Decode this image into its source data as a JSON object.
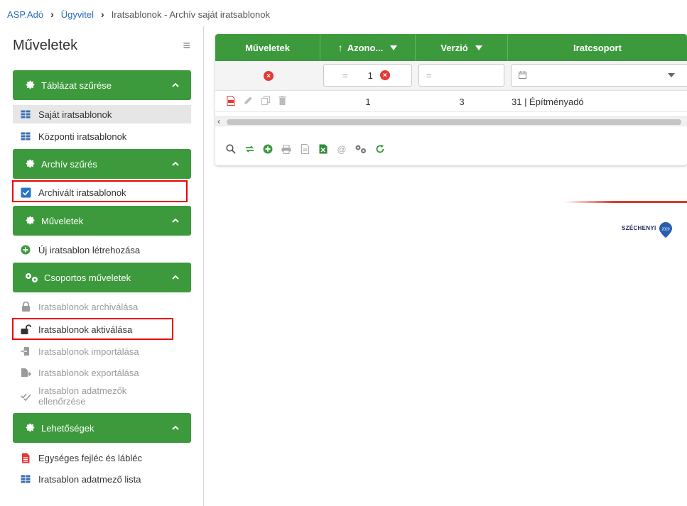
{
  "breadcrumb": {
    "items": [
      "ASP.Adó",
      "Ügyvitel"
    ],
    "current": "Iratsablonok - Archív saját iratsablonok"
  },
  "sidebar": {
    "title": "Műveletek",
    "groups": [
      {
        "label": "Táblázat szűrése",
        "icon": "gear-icon",
        "items": [
          {
            "label": "Saját iratsablonok",
            "icon": "table-icon",
            "state": "active"
          },
          {
            "label": "Központi iratsablonok",
            "icon": "table-icon",
            "state": "normal"
          }
        ]
      },
      {
        "label": "Archív szűrés",
        "icon": "gear-icon",
        "items": [
          {
            "label": "Archivált iratsablonok",
            "icon": "checkbox-checked-icon",
            "state": "highlighted",
            "checked": true
          }
        ]
      },
      {
        "label": "Műveletek",
        "icon": "gear-icon",
        "items": [
          {
            "label": "Új iratsablon létrehozása",
            "icon": "plus-circle-icon",
            "state": "normal"
          }
        ]
      },
      {
        "label": "Csoportos műveletek",
        "icon": "gears-icon",
        "items": [
          {
            "label": "Iratsablonok archiválása",
            "icon": "lock-icon",
            "state": "disabled"
          },
          {
            "label": "Iratsablonok aktiválása",
            "icon": "unlock-icon",
            "state": "highlighted"
          },
          {
            "label": "Iratsablonok importálása",
            "icon": "import-icon",
            "state": "disabled"
          },
          {
            "label": "Iratsablonok exportálása",
            "icon": "export-icon",
            "state": "disabled"
          },
          {
            "label": "Iratsablon adatmezők ellenőrzése",
            "icon": "check-double-icon",
            "state": "disabled"
          }
        ]
      },
      {
        "label": "Lehetőségek",
        "icon": "gear-icon",
        "items": [
          {
            "label": "Egységes fejléc és lábléc",
            "icon": "file-icon",
            "state": "normal"
          },
          {
            "label": "Iratsablon adatmező lista",
            "icon": "table-icon",
            "state": "normal"
          }
        ]
      }
    ]
  },
  "grid": {
    "columns": [
      {
        "label": "Műveletek"
      },
      {
        "label": "Azono...",
        "sort": "asc",
        "filterable": true
      },
      {
        "label": "Verzió",
        "filterable": true
      },
      {
        "label": "Iratcsoport"
      }
    ],
    "filters": {
      "azonosito_op": "=",
      "azonosito_value": "1",
      "verzio_op": "=",
      "iratcsoport_icon": "calendar-icon"
    },
    "rows": [
      {
        "azonosito": "1",
        "verzio": "3",
        "iratcsoport": "31 | Építményadó"
      }
    ]
  },
  "colors": {
    "green": "#3d9a3c",
    "red": "#e53935",
    "link": "#2a6db5"
  },
  "logo": {
    "text": "SZÉCHENYI",
    "year": "2020"
  }
}
